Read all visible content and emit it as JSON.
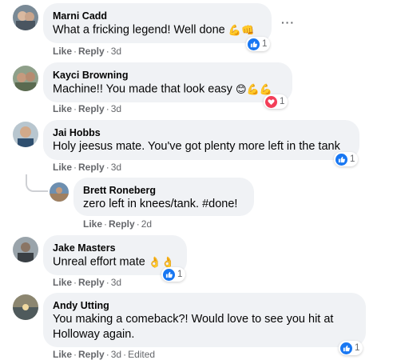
{
  "colors": {
    "bubble": "#f0f2f5",
    "meta": "#65676b",
    "like_blue": "#1877f2",
    "love_red": "#f33e58"
  },
  "comments": [
    {
      "author": "Marni Cadd",
      "text": "What a fricking legend! Well done",
      "emoji": "💪👊",
      "actions": {
        "like": "Like",
        "reply": "Reply",
        "time": "3d",
        "edited": ""
      },
      "reaction": {
        "type": "like",
        "count": "1"
      },
      "more": "···"
    },
    {
      "author": "Kayci Browning",
      "text": "Machine!! You made that look easy",
      "emoji": "😊💪💪",
      "actions": {
        "like": "Like",
        "reply": "Reply",
        "time": "3d",
        "edited": ""
      },
      "reaction": {
        "type": "love",
        "count": "1"
      }
    },
    {
      "author": "Jai Hobbs",
      "text": "Holy jeesus mate. You've got plenty more left in the tank",
      "emoji": "",
      "actions": {
        "like": "Like",
        "reply": "Reply",
        "time": "3d",
        "edited": ""
      },
      "reaction": {
        "type": "like",
        "count": "1"
      }
    },
    {
      "author": "Brett Roneberg",
      "text": "zero left in knees/tank. #done!",
      "emoji": "",
      "actions": {
        "like": "Like",
        "reply": "Reply",
        "time": "2d",
        "edited": ""
      }
    },
    {
      "author": "Jake Masters",
      "text": "Unreal effort mate",
      "emoji": "👌👌",
      "actions": {
        "like": "Like",
        "reply": "Reply",
        "time": "3d",
        "edited": ""
      },
      "reaction": {
        "type": "like",
        "count": "1"
      }
    },
    {
      "author": "Andy Utting",
      "text_line1": "You making a comeback?! Would love to see you hit at",
      "text_line2": "Holloway again.",
      "actions": {
        "like": "Like",
        "reply": "Reply",
        "time": "3d",
        "edited": "Edited"
      },
      "reaction": {
        "type": "like",
        "count": "1"
      }
    }
  ],
  "separator": "·"
}
